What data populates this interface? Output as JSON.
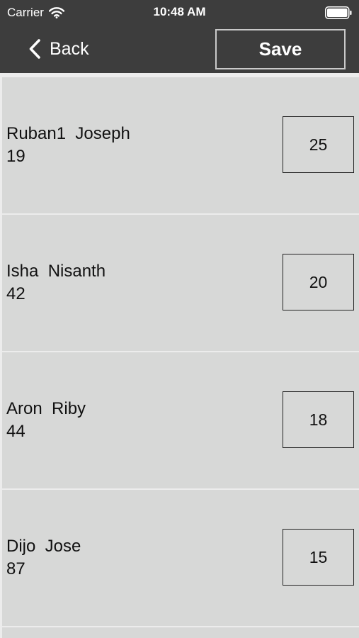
{
  "status_bar": {
    "carrier": "Carrier",
    "time": "10:48 AM",
    "icons": [
      "wifi-icon",
      "battery-icon"
    ]
  },
  "nav": {
    "back_label": "Back",
    "save_label": "Save"
  },
  "colors": {
    "bar_background": "#3d3d3d",
    "list_background": "#d7d8d7",
    "separator": "#ececec"
  },
  "items": [
    {
      "name": "Ruban1  Joseph",
      "number": "19",
      "score": "25"
    },
    {
      "name": "Isha  Nisanth",
      "number": "42",
      "score": "20"
    },
    {
      "name": "Aron  Riby",
      "number": "44",
      "score": "18"
    },
    {
      "name": "Dijo  Jose",
      "number": "87",
      "score": "15"
    }
  ]
}
